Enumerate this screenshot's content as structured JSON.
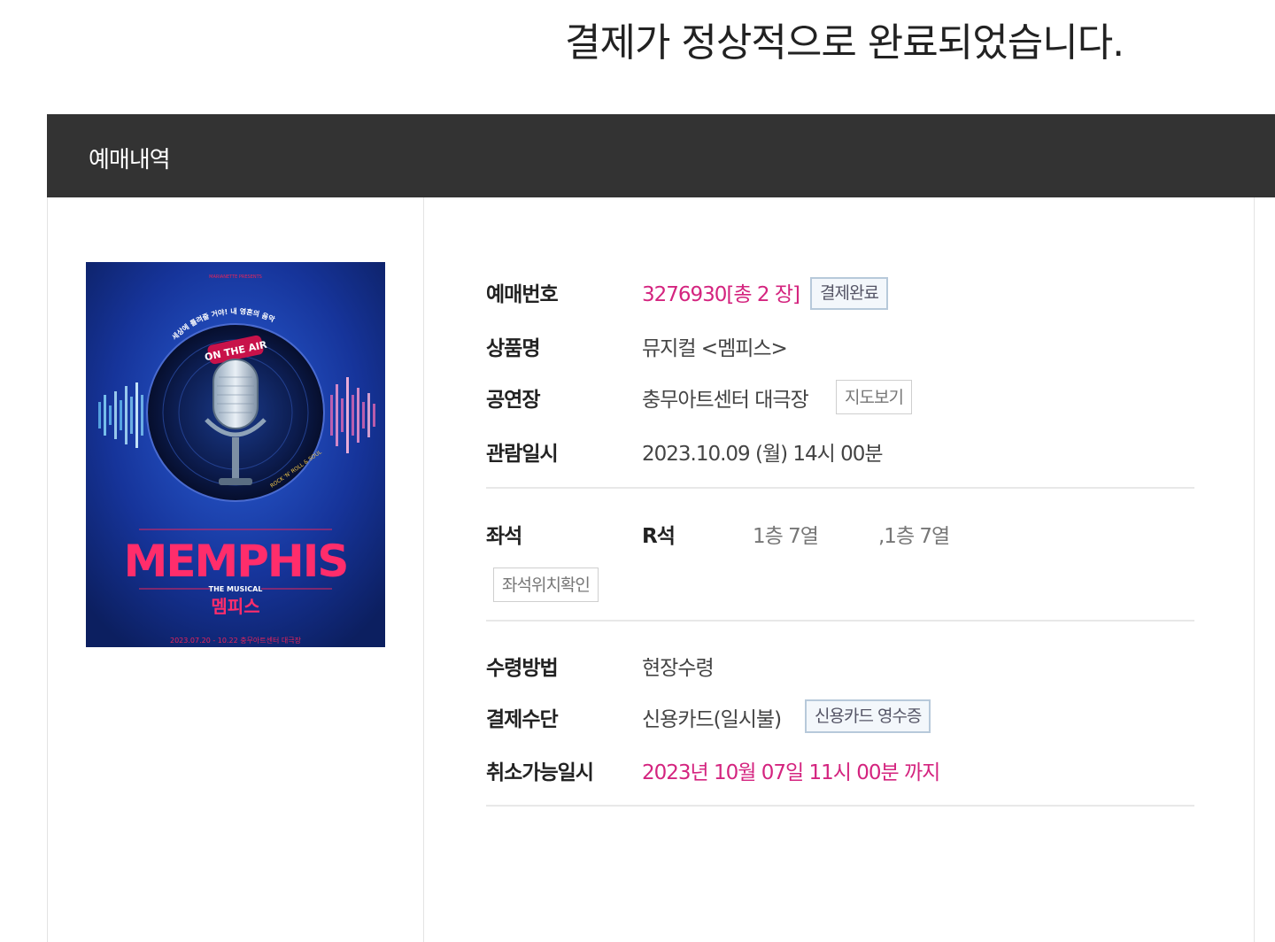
{
  "headline": "결제가 정상적으로 완료되었습니다.",
  "section": {
    "title": "예매내역"
  },
  "poster": {
    "presenter": "MARIANETTE PRESENTS",
    "arc_text": "세상에 틀려줄 거야! 내 영혼의 음악",
    "badge": "ON THE AIR",
    "subtitle_small": "ROCK 'N' ROLL & SOUL",
    "title": "MEMPHIS",
    "kicker": "THE MUSICAL",
    "title_kr": "멤피스",
    "footer": "2023.07.20 - 10.22  충무아트센터 대극장",
    "colors": {
      "bg": "#14308a",
      "accent": "#e8245a"
    }
  },
  "details": {
    "booking_no": {
      "label": "예매번호",
      "value": "3276930[총 2 장]",
      "badge": "결제완료"
    },
    "product": {
      "label": "상품명",
      "value": "뮤지컬 <멤피스>"
    },
    "venue": {
      "label": "공연장",
      "value": "충무아트센터 대극장",
      "button": "지도보기"
    },
    "datetime": {
      "label": "관람일시",
      "value": "2023.10.09 (월) 14시 00분"
    },
    "seat": {
      "label": "좌석",
      "grade": "R석",
      "seat1": "1층 7열",
      "seat2": ",1층 7열",
      "button": "좌석위치확인"
    },
    "pickup": {
      "label": "수령방법",
      "value": "현장수령"
    },
    "payment": {
      "label": "결제수단",
      "value": "신용카드(일시불)",
      "button": "신용카드 영수증"
    },
    "cancel": {
      "label": "취소가능일시",
      "value": "2023년 10월 07일 11시 00분 까지"
    }
  },
  "colors": {
    "accent": "#d4247f",
    "header_bg": "#333333"
  }
}
